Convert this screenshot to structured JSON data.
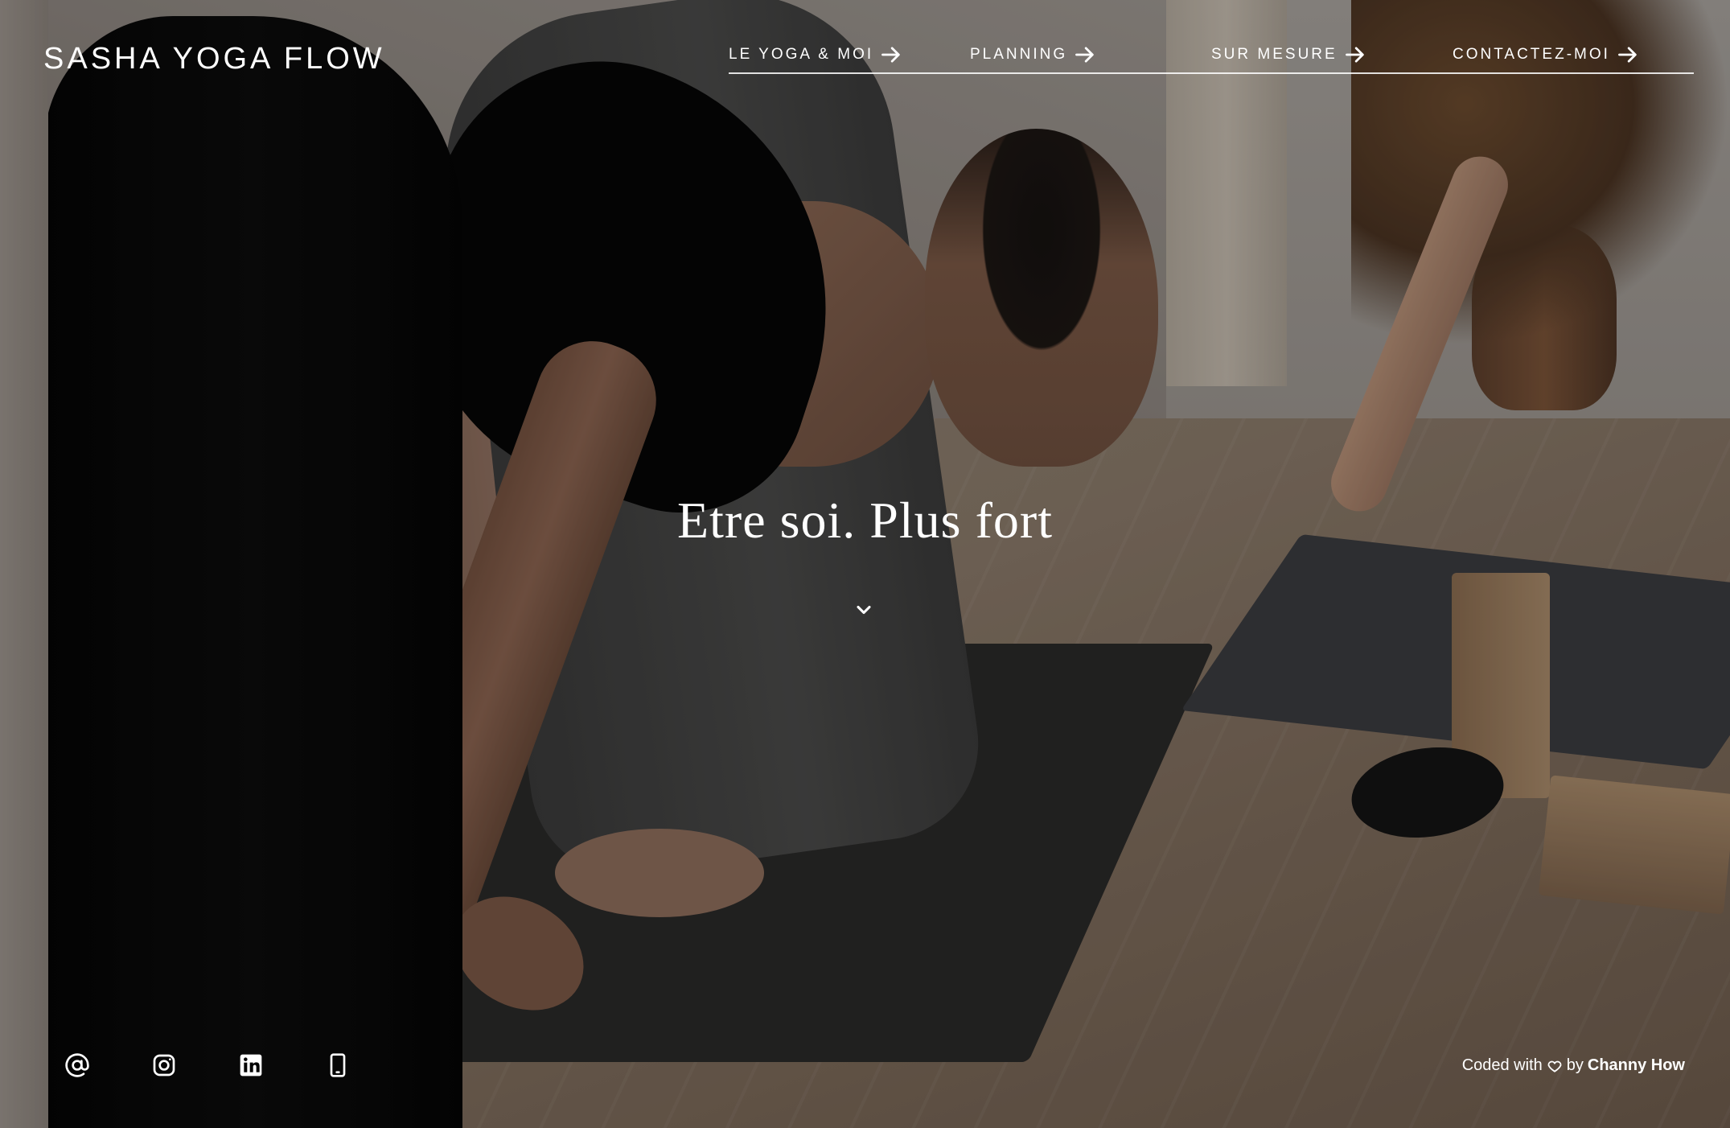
{
  "brand": {
    "name": "SASHA YOGA FLOW"
  },
  "nav": {
    "items": [
      {
        "label": "LE YOGA & MOI"
      },
      {
        "label": "PLANNING"
      },
      {
        "label": "SUR MESURE"
      },
      {
        "label": "CONTACTEZ-MOI"
      }
    ]
  },
  "hero": {
    "tagline": "Etre soi. Plus fort"
  },
  "footer": {
    "social_icons": [
      "at-email-icon",
      "instagram-icon",
      "linkedin-icon",
      "mobile-phone-icon"
    ],
    "credit_prefix": "Coded with",
    "credit_by": "by",
    "credit_author": "Channy How"
  },
  "colors": {
    "text": "#ffffff",
    "overlay": "rgba(0,0,0,0.22)"
  }
}
